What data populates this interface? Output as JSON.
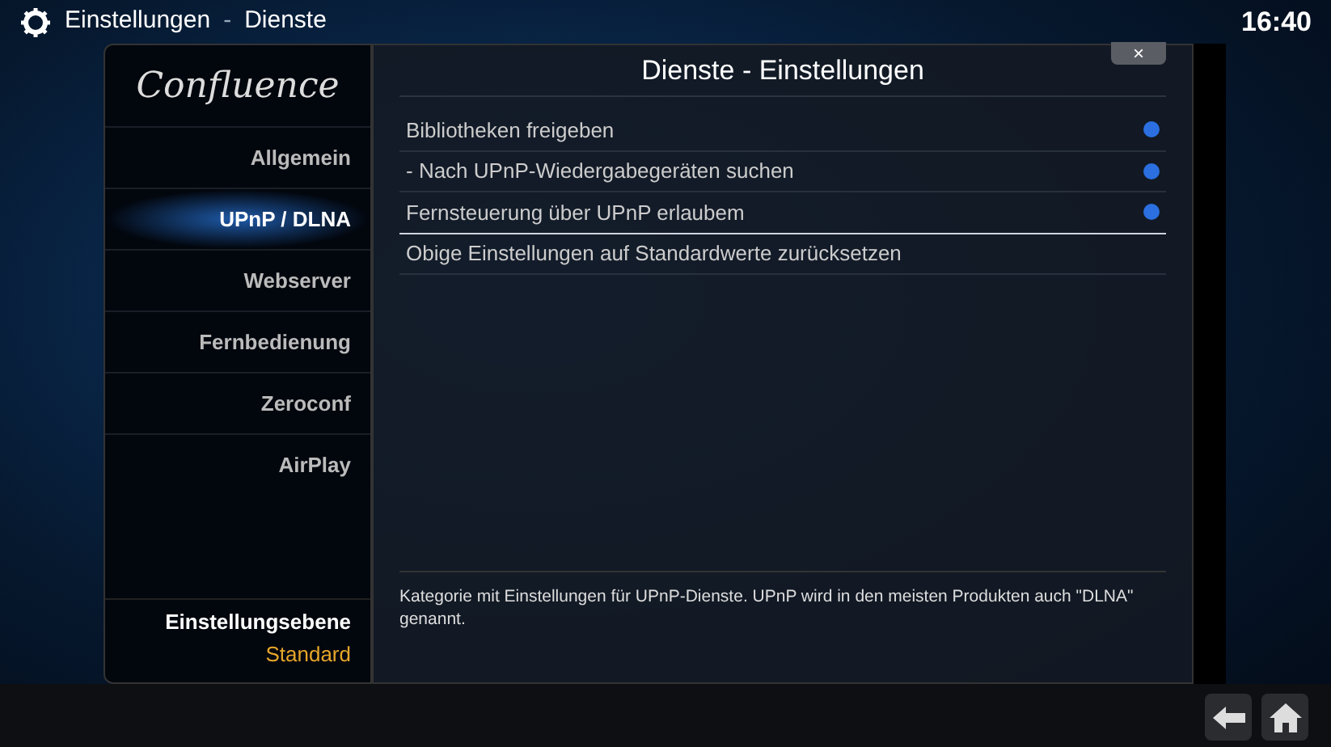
{
  "header": {
    "title": "Einstellungen",
    "separator": "-",
    "section": "Dienste",
    "time": "16:40"
  },
  "sidebar": {
    "logo": "Confluence",
    "items": [
      {
        "label": "Allgemein",
        "selected": false
      },
      {
        "label": "UPnP / DLNA",
        "selected": true
      },
      {
        "label": "Webserver",
        "selected": false
      },
      {
        "label": "Fernbedienung",
        "selected": false
      },
      {
        "label": "Zeroconf",
        "selected": false
      },
      {
        "label": "AirPlay",
        "selected": false
      }
    ],
    "level_label": "Einstellungsebene",
    "level_value": "Standard"
  },
  "dialog": {
    "title": "Dienste - Einstellungen",
    "close": "×",
    "settings": [
      {
        "label": "Bibliotheken freigeben",
        "kind": "toggle",
        "on": true,
        "selected": false
      },
      {
        "label": "- Nach UPnP-Wiedergabegeräten suchen",
        "kind": "toggle",
        "on": true,
        "selected": false
      },
      {
        "label": "Fernsteuerung über UPnP erlaubem",
        "kind": "toggle",
        "on": true,
        "selected": true
      },
      {
        "label": "Obige Einstellungen auf Standardwerte zurücksetzen",
        "kind": "action",
        "selected": false
      }
    ],
    "description": "Kategorie mit Einstellungen für UPnP-Dienste. UPnP wird in den meisten Produkten auch \"DLNA\" genannt."
  }
}
